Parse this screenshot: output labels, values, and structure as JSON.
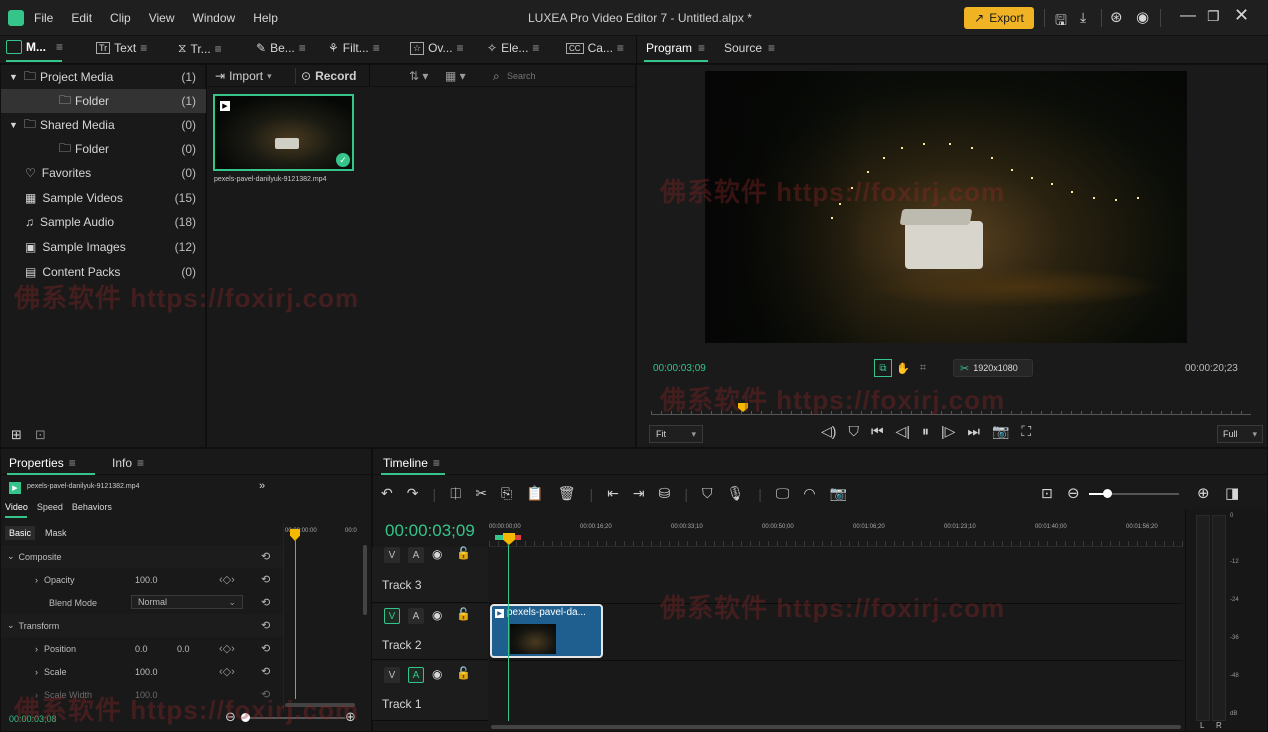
{
  "app": {
    "menu": [
      "File",
      "Edit",
      "Clip",
      "View",
      "Window",
      "Help"
    ],
    "title": "LUXEA Pro Video Editor 7 - Untitled.alpx *",
    "export_label": "Export"
  },
  "toolbar_tabs": [
    {
      "label": "M..."
    },
    {
      "label": "Text"
    },
    {
      "label": "Tr..."
    },
    {
      "label": "Be..."
    },
    {
      "label": "Filt..."
    },
    {
      "label": "Ov..."
    },
    {
      "label": "Ele..."
    },
    {
      "label": "Ca..."
    }
  ],
  "media_tree": [
    {
      "label": "Project Media",
      "count": "(1)"
    },
    {
      "label": "Folder",
      "count": "(1)"
    },
    {
      "label": "Shared Media",
      "count": "(0)"
    },
    {
      "label": "Folder",
      "count": "(0)"
    },
    {
      "label": "Favorites",
      "count": "(0)"
    },
    {
      "label": "Sample Videos",
      "count": "(15)"
    },
    {
      "label": "Sample Audio",
      "count": "(18)"
    },
    {
      "label": "Sample Images",
      "count": "(12)"
    },
    {
      "label": "Content Packs",
      "count": "(0)"
    }
  ],
  "media_bar": {
    "import": "Import",
    "record": "Record",
    "search_placeholder": "Search"
  },
  "media_item": {
    "filename": "pexels-pavel-danilyuk-9121382.mp4"
  },
  "viewer": {
    "tab_program": "Program",
    "tab_source": "Source",
    "current_time": "00:00:03;09",
    "duration": "00:00:20;23",
    "resolution": "1920x1080",
    "fit": "Fit",
    "quality": "Full"
  },
  "properties": {
    "tab_properties": "Properties",
    "tab_info": "Info",
    "clip_name": "pexels-pavel-danilyuk-9121382.mp4",
    "subtabs": [
      "Video",
      "Speed",
      "Behaviors"
    ],
    "basic": "Basic",
    "mask": "Mask",
    "kf_time_a": "00:00:00:00",
    "kf_time_b": "00:0",
    "composite": "Composite",
    "opacity_label": "Opacity",
    "opacity_value": "100.0",
    "blend_label": "Blend Mode",
    "blend_value": "Normal",
    "transform": "Transform",
    "position_label": "Position",
    "position_x": "0.0",
    "position_y": "0.0",
    "scale_label": "Scale",
    "scale_value": "100.0",
    "scale_width_label": "Scale Width",
    "scale_width_value": "100.0",
    "footer_time": "00:00:03;08"
  },
  "timeline": {
    "tab": "Timeline",
    "timecode": "00:00:03;09",
    "ruler": [
      "00:00:00;00",
      "00:00:16;20",
      "00:00:33;10",
      "00:00:50;00",
      "00:01:06;20",
      "00:01:23;10",
      "00:01:40;00",
      "00:01:56;20"
    ],
    "tracks": [
      {
        "name": "Track 3"
      },
      {
        "name": "Track 2"
      },
      {
        "name": "Track 1"
      }
    ],
    "clip_label": "pexels-pavel-da...",
    "meter_marks": [
      "0",
      "-12",
      "-24",
      "-36",
      "-48",
      "dB"
    ],
    "meter_lr": [
      "L",
      "R"
    ]
  },
  "watermark": "佛系软件 https://foxirj.com",
  "colors": {
    "accent": "#35c48a",
    "export": "#f0b323",
    "playhead": "#f5b800",
    "clip": "#1f5f8f"
  }
}
